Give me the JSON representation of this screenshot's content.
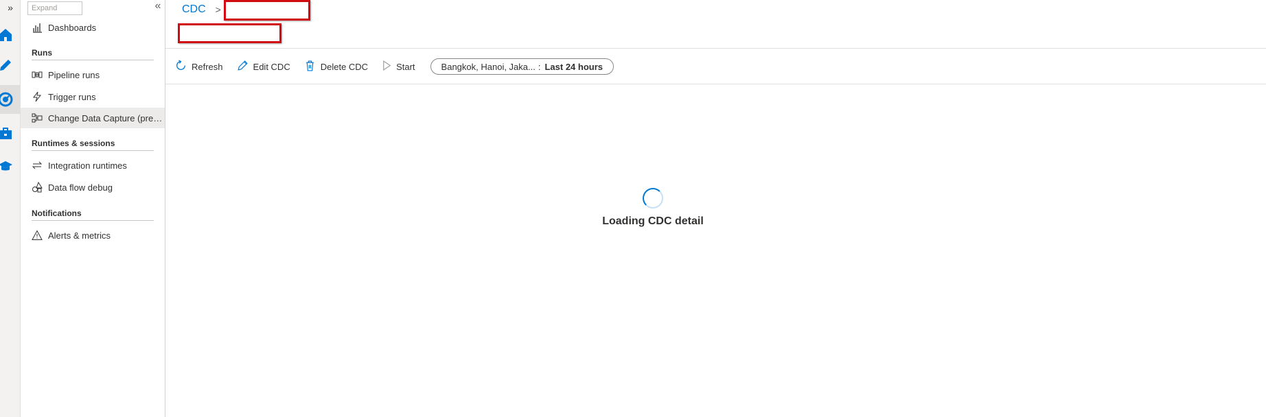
{
  "rail": {
    "expand_glyph": "»",
    "icons": [
      "home-icon",
      "pencil-icon",
      "monitor-gauge-icon",
      "toolbox-icon",
      "learn-cap-icon"
    ],
    "accent": "#0078d4"
  },
  "nav": {
    "expand_tooltip": "Expand",
    "collapse_glyph": "«",
    "dashboards": "Dashboards",
    "sections": {
      "runs": "Runs",
      "runtimes": "Runtimes & sessions",
      "notifications": "Notifications"
    },
    "items": {
      "pipeline_runs": "Pipeline runs",
      "trigger_runs": "Trigger runs",
      "cdc": "Change Data Capture (preview)",
      "integration_runtimes": "Integration runtimes",
      "data_flow_debug": "Data flow debug",
      "alerts_metrics": "Alerts & metrics"
    }
  },
  "breadcrumb": {
    "root": "CDC",
    "separator": ">"
  },
  "toolbar": {
    "refresh": "Refresh",
    "edit": "Edit CDC",
    "delete": "Delete CDC",
    "start": "Start",
    "timezone": "Bangkok, Hanoi, Jaka...",
    "tz_separator": ":",
    "time_range": "Last 24 hours"
  },
  "loading": {
    "text": "Loading CDC detail"
  },
  "colors": {
    "accent": "#0078d4",
    "redaction_border": "#d20a11"
  }
}
